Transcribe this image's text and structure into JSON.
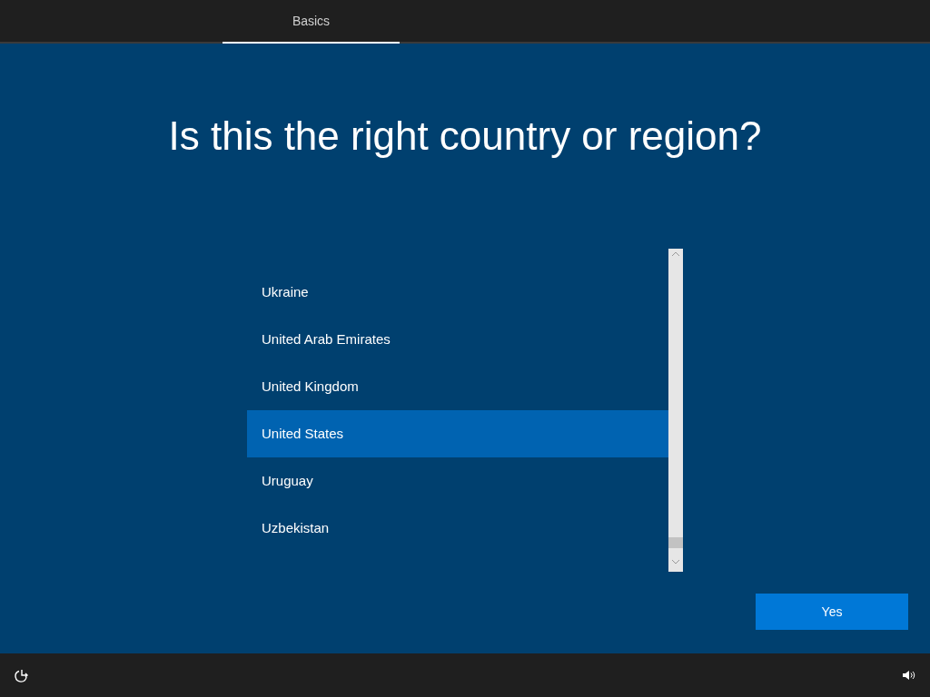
{
  "tabs": [
    {
      "label": "Basics",
      "selected": true
    }
  ],
  "heading": "Is this the right country or region?",
  "countries": [
    {
      "name": "Ukraine",
      "selected": false
    },
    {
      "name": "United Arab Emirates",
      "selected": false
    },
    {
      "name": "United Kingdom",
      "selected": false
    },
    {
      "name": "United States",
      "selected": true
    },
    {
      "name": "Uruguay",
      "selected": false
    },
    {
      "name": "Uzbekistan",
      "selected": false
    }
  ],
  "buttons": [
    {
      "label": "Yes"
    }
  ]
}
